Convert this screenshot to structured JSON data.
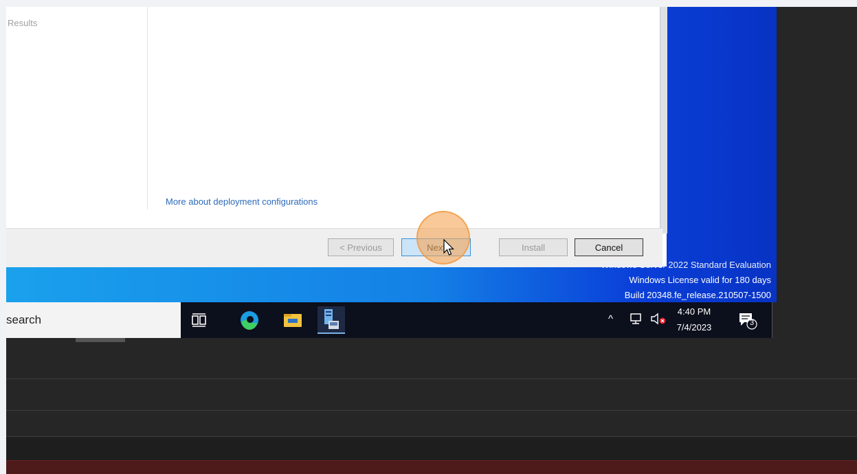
{
  "wizard": {
    "side_results_label": "Results",
    "more_link": "More about deployment configurations",
    "buttons": {
      "previous": "< Previous",
      "next": "Next",
      "install": "Install",
      "cancel": "Cancel"
    }
  },
  "watermark": {
    "line1": "Windows Server 2022 Standard Evaluation",
    "line2": "Windows License valid for 180 days",
    "line3": "Build 20348.fe_release.210507-1500"
  },
  "taskbar": {
    "search_text": "search",
    "icons": [
      "task-view-icon",
      "edge-icon",
      "file-explorer-icon",
      "server-manager-icon"
    ],
    "tray": {
      "time": "4:40 PM",
      "date": "7/4/2023",
      "notification_count": "3"
    }
  },
  "colors": {
    "desktop_blue": "#1480e6",
    "link_blue": "#2d6ab8",
    "next_highlight": "#cce4f7",
    "click_indicator": "#f5a555"
  }
}
